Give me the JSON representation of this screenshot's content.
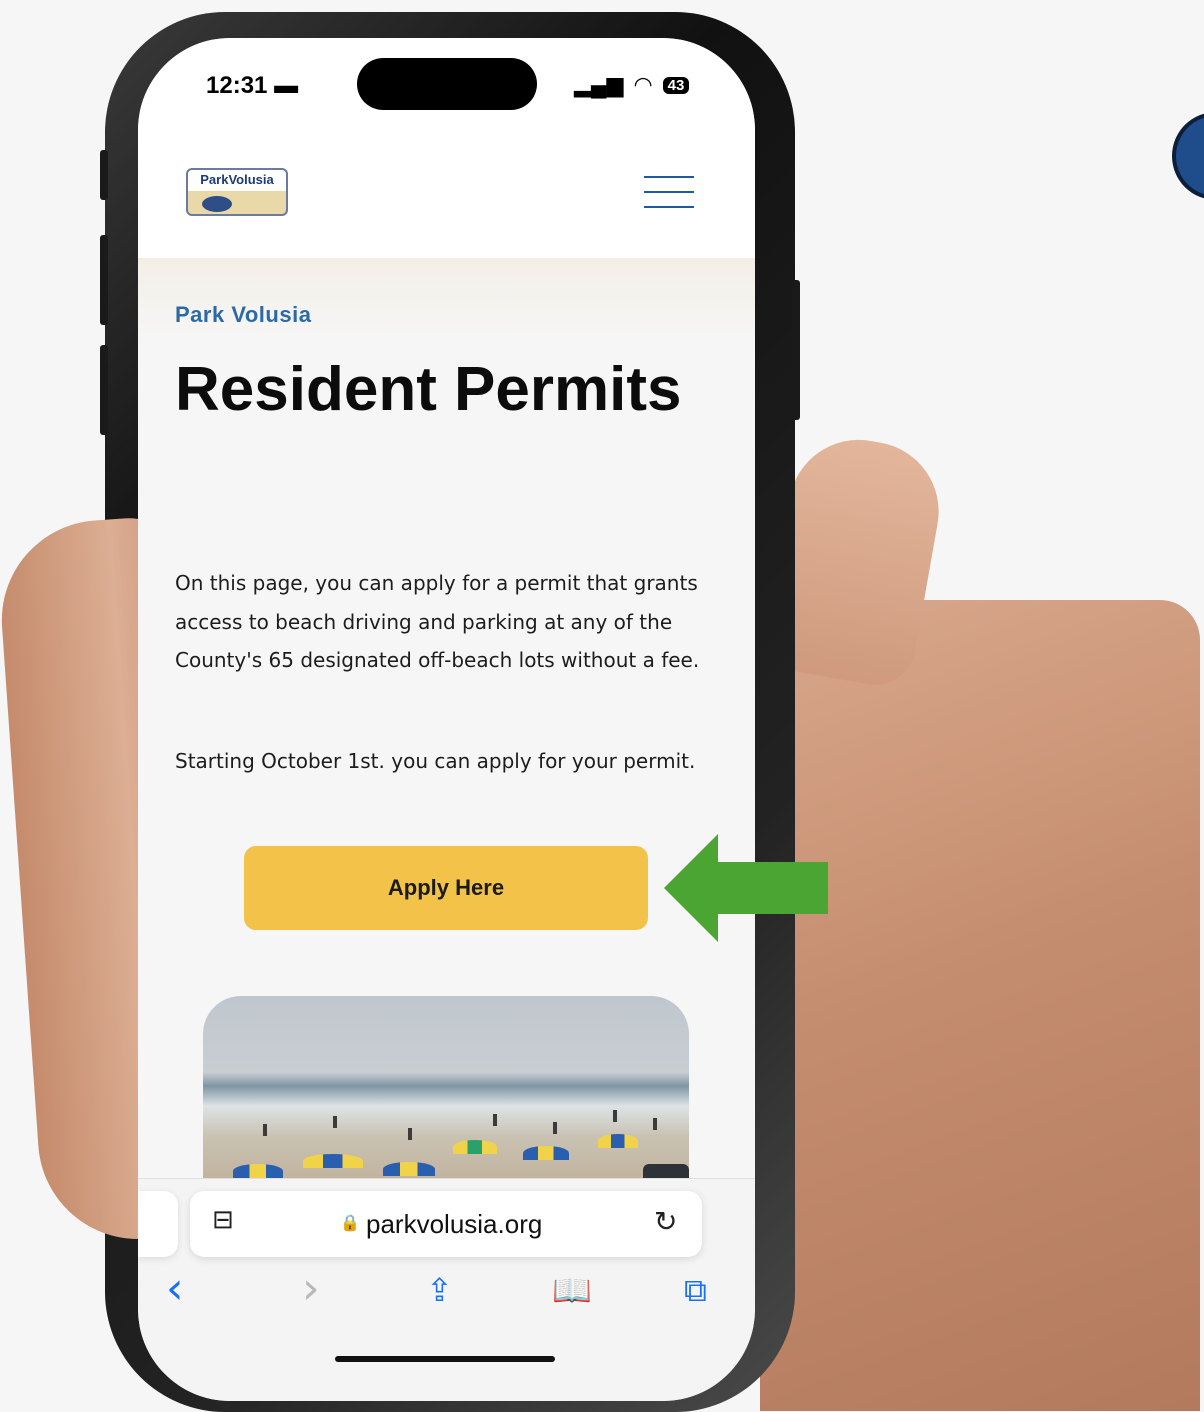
{
  "status_bar": {
    "time": "12:31",
    "signal": "▂▄▆",
    "wifi": "◠",
    "battery": "43"
  },
  "site": {
    "logo_text": "ParkVolusia",
    "eyebrow": "Park Volusia",
    "title": "Resident Permits",
    "paragraph1": "On this page, you can apply for a permit that grants access to beach driving and parking at any of the County's 65 designated off-beach lots without a fee.",
    "paragraph2": "Starting October 1st. you can apply for your permit.",
    "apply_button": "Apply Here"
  },
  "browser": {
    "url": "parkvolusia.org",
    "lock": "🔒",
    "page_menu_icon": "⊟",
    "reload_icon": "↻",
    "back": "‹",
    "forward": "›",
    "share": "⇪",
    "bookmarks": "📖",
    "tabs": "⧉"
  },
  "colors": {
    "accent_blue": "#2c6aa5",
    "button_yellow": "#f3c349",
    "arrow_green": "#4aa532"
  }
}
